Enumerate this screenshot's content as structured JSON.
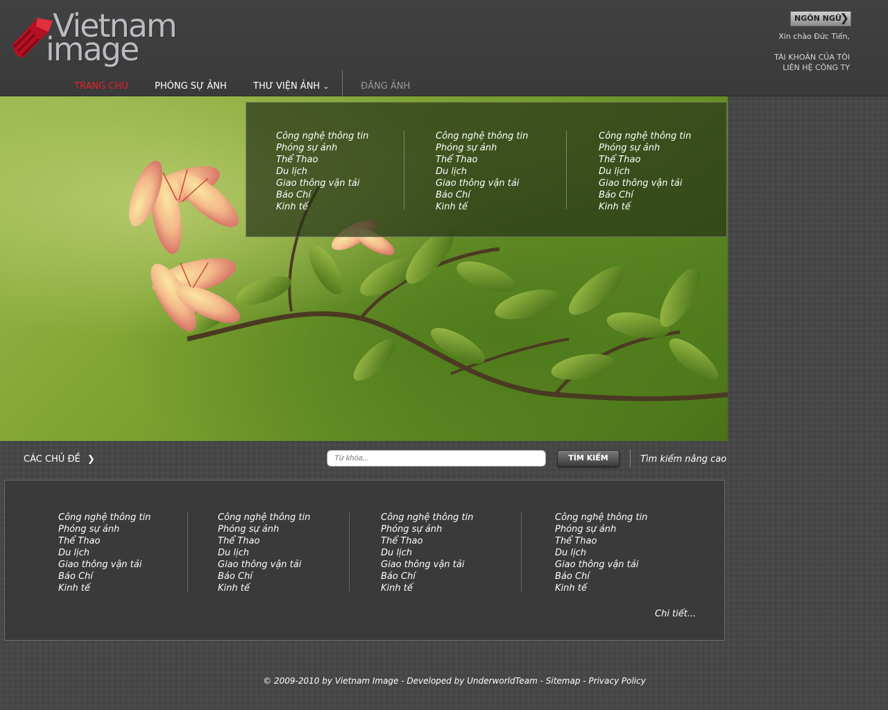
{
  "site": {
    "logo_line1": "Vietnam",
    "logo_line2": "image",
    "brand_color": "#c8102e"
  },
  "header": {
    "language_label": "NGÔN NGỮ",
    "greeting": "Xin chào Đức Tiến,",
    "my_account": "TÀI KHOẢN CỦA TÔI",
    "contact": "LIÊN HỆ CÔNG TY"
  },
  "nav": {
    "home": "TRANG CHỦ",
    "photo_reports": "PHÓNG SỰ ẢNH",
    "photo_library": "THƯ VIỆN ẢNH",
    "upload": "ĐĂNG ẢNH",
    "active_color": "#e8202a"
  },
  "dropdown": {
    "columns": [
      [
        "Công nghệ thông tin",
        "Phóng sự ảnh",
        "Thể Thao",
        "Du lịch",
        "Giao thông vận tải",
        "Báo Chí",
        "Kinh tế"
      ],
      [
        "Công nghệ thông tin",
        "Phóng sự ảnh",
        "Thể Thao",
        "Du lịch",
        "Giao thông vận tải",
        "Báo Chí",
        "Kinh tế"
      ],
      [
        "Công nghệ thông tin",
        "Phóng sự ảnh",
        "Thể Thao",
        "Du lịch",
        "Giao thông vận tải",
        "Báo Chí",
        "Kinh tế"
      ]
    ]
  },
  "search": {
    "topics_label": "CÁC CHỦ ĐỀ",
    "placeholder": "Từ khóa...",
    "button_label": "TÌM KIẾM",
    "advanced_label": "Tìm kiếm nâng cao"
  },
  "categories": {
    "columns": [
      [
        "Công nghệ thông tin",
        "Phóng sự ảnh",
        "Thể Thao",
        "Du lịch",
        "Giao thông vận tải",
        "Báo Chí",
        "Kinh tế"
      ],
      [
        "Công nghệ thông tin",
        "Phóng sự ảnh",
        "Thể Thao",
        "Du lịch",
        "Giao thông vận tải",
        "Báo Chí",
        "Kinh tế"
      ],
      [
        "Công nghệ thông tin",
        "Phóng sự ảnh",
        "Thể Thao",
        "Du lịch",
        "Giao thông vận tải",
        "Báo Chí",
        "Kinh tế"
      ],
      [
        "Công nghệ thông tin",
        "Phóng sự ảnh",
        "Thể Thao",
        "Du lịch",
        "Giao thông vận tải",
        "Báo Chí",
        "Kinh tế"
      ]
    ],
    "more_label": "Chi tiết..."
  },
  "footer": {
    "text": "© 2009-2010 by Vietnam Image - Developed by UnderworldTeam - Sitemap - Privacy Policy"
  }
}
